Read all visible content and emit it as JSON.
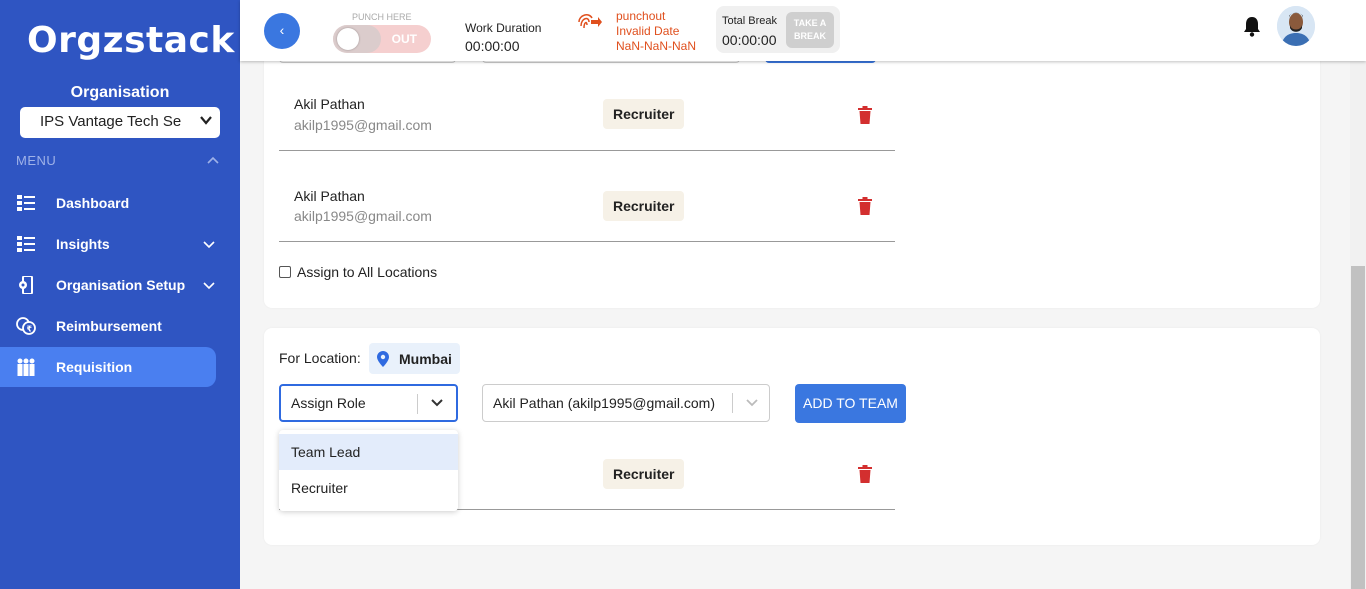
{
  "sidebar": {
    "logo": "Orgzstack",
    "org_label": "Organisation",
    "org_select": "IPS Vantage Tech Se",
    "menu_label": "MENU",
    "items": [
      {
        "label": "Dashboard",
        "icon": "dashboard-icon",
        "has_caret": false
      },
      {
        "label": "Insights",
        "icon": "insights-icon",
        "has_caret": true
      },
      {
        "label": "Organisation Setup",
        "icon": "organisation-setup-icon",
        "has_caret": true
      },
      {
        "label": "Reimbursement",
        "icon": "reimbursement-icon",
        "has_caret": false
      },
      {
        "label": "Requisition",
        "icon": "requisition-icon",
        "has_caret": false,
        "active": true
      }
    ]
  },
  "topbar": {
    "back": "‹",
    "punch_here": "PUNCH HERE",
    "punch_state": "OUT",
    "work_label": "Work Duration",
    "work_value": "00:00:00",
    "punchout_text": "punchout Invalid Date NaN-NaN-NaN",
    "break_label": "Total Break",
    "break_value": "00:00:00",
    "take_break": "TAKE A BREAK"
  },
  "card1": {
    "members": [
      {
        "name": "Akil Pathan",
        "email": "akilp1995@gmail.com",
        "role": "Recruiter"
      },
      {
        "name": "Akil Pathan",
        "email": "akilp1995@gmail.com",
        "role": "Recruiter"
      }
    ],
    "assign_all": "Assign to All Locations"
  },
  "card2": {
    "for_location": "For Location:",
    "location": "Mumbai",
    "role_select": "Assign Role",
    "person_select": "Akil Pathan (akilp1995@gmail.com)",
    "add_button": "ADD TO TEAM",
    "member_role": "Recruiter",
    "dropdown_options": [
      "Team Lead",
      "Recruiter"
    ]
  },
  "colors": {
    "sidebar": "#2f55c2",
    "accent": "#3a77e0",
    "danger": "#d32f2f",
    "punchout": "#e0501e"
  }
}
